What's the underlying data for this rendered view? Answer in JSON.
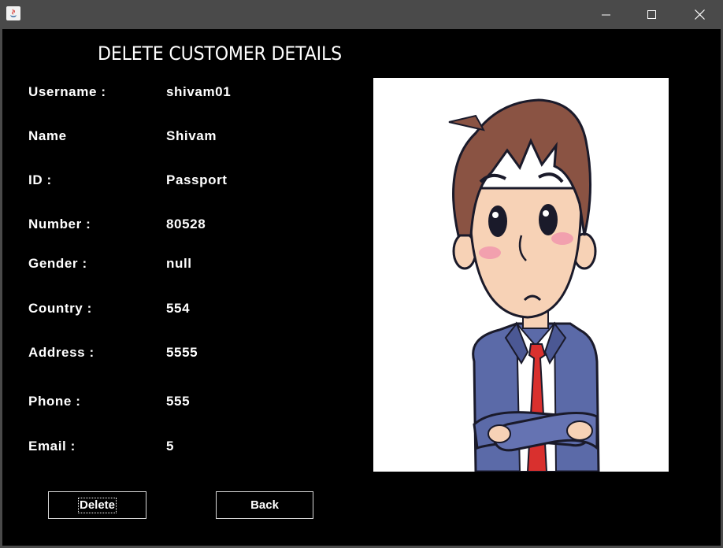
{
  "window": {
    "controls": {
      "minimize_icon": "minimize-icon",
      "maximize_icon": "maximize-icon",
      "close_icon": "close-icon"
    }
  },
  "heading": "DELETE CUSTOMER DETAILS",
  "fields": {
    "username": {
      "label": "Username :",
      "value": "shivam01"
    },
    "name": {
      "label": "Name",
      "value": "Shivam"
    },
    "id": {
      "label": "ID :",
      "value": "Passport"
    },
    "number": {
      "label": "Number :",
      "value": "80528"
    },
    "gender": {
      "label": "Gender :",
      "value": "null"
    },
    "country": {
      "label": "Country :",
      "value": "554"
    },
    "address": {
      "label": "Address :",
      "value": "5555"
    },
    "phone": {
      "label": "Phone :",
      "value": "555"
    },
    "email": {
      "label": "Email :",
      "value": "5"
    }
  },
  "buttons": {
    "delete": "Delete",
    "back": "Back"
  },
  "colors": {
    "background": "#000000",
    "text": "#ffffff",
    "titlebar": "#4a4a4a"
  }
}
